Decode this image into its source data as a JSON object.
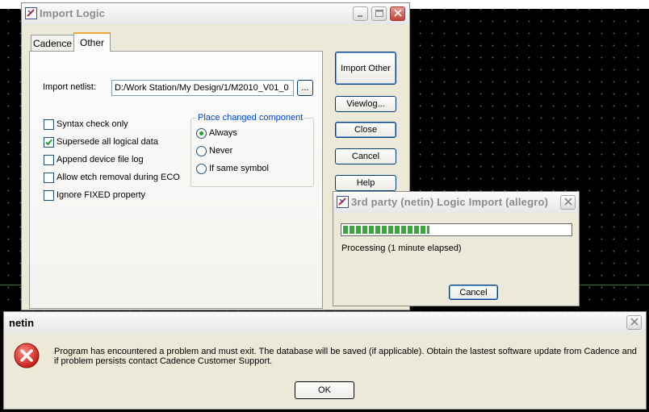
{
  "import_logic": {
    "title": "Import Logic",
    "tabs": [
      {
        "label": "Cadence",
        "active": false
      },
      {
        "label": "Other",
        "active": true
      }
    ],
    "netlist": {
      "label": "Import netlist:",
      "value": "D:/Work Station/My Design/1/M2010_V01_0",
      "browse_label": "..."
    },
    "checkboxes": [
      {
        "label": "Syntax check only",
        "checked": false
      },
      {
        "label": "Supersede all logical data",
        "checked": true
      },
      {
        "label": "Append device file log",
        "checked": false
      },
      {
        "label": "Allow etch removal during ECO",
        "checked": false
      },
      {
        "label": "Ignore FIXED property",
        "checked": false
      }
    ],
    "place_group": {
      "title": "Place changed component",
      "options": [
        {
          "label": "Always",
          "selected": true
        },
        {
          "label": "Never",
          "selected": false
        },
        {
          "label": "If same symbol",
          "selected": false
        }
      ]
    },
    "buttons": {
      "import_other": "Import Other",
      "viewlog": "Viewlog...",
      "close": "Close",
      "cancel": "Cancel",
      "help": "Help"
    }
  },
  "progress_dialog": {
    "title": "3rd party (netin) Logic Import (allegro)",
    "status": "Processing (1 minute  elapsed)",
    "progress_fraction": 0.38,
    "cancel_label": "Cancel"
  },
  "error_dialog": {
    "title": "netin",
    "message": "Program has encountered a problem and must exit. The database will be saved (if applicable). Obtain the lastest software update from Cadence and if problem persists contact Cadence Customer Support.",
    "ok_label": "OK"
  },
  "colors": {
    "title_text_inactive": "#8a8a8a",
    "group_title": "#0046d5",
    "close_button_red": "#c1443a",
    "progress_green": "#3fa33f",
    "error_red": "#d6241c"
  }
}
